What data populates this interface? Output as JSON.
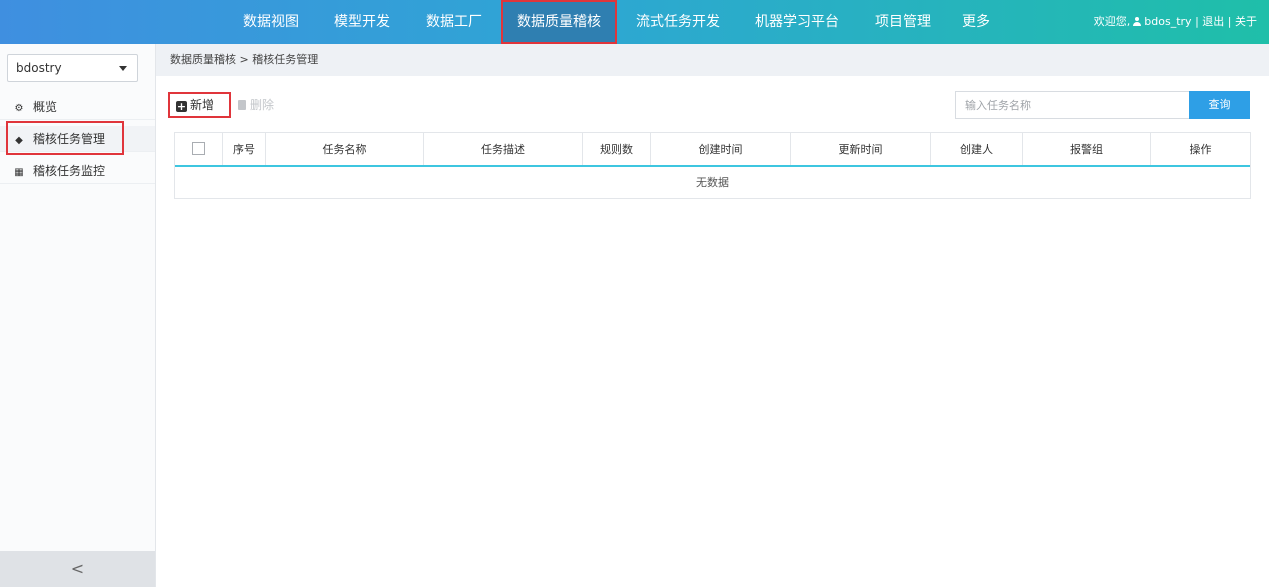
{
  "topnav": {
    "items": [
      {
        "label": "数据视图",
        "active": false
      },
      {
        "label": "模型开发",
        "active": false
      },
      {
        "label": "数据工厂",
        "active": false
      },
      {
        "label": "数据质量稽核",
        "active": true
      },
      {
        "label": "流式任务开发",
        "active": false
      },
      {
        "label": "机器学习平台",
        "active": false
      },
      {
        "label": "项目管理",
        "active": false
      },
      {
        "label": "更多",
        "active": false
      }
    ],
    "welcome": "欢迎您,",
    "username": "bdos_try",
    "separator": "|",
    "logout": "退出",
    "about": "关于"
  },
  "sidebar": {
    "project": "bdostry",
    "items": [
      {
        "label": "概览",
        "icon": "cogs-icon",
        "active": false
      },
      {
        "label": "稽核任务管理",
        "icon": "cube-icon",
        "active": true
      },
      {
        "label": "稽核任务监控",
        "icon": "grid-icon",
        "active": false
      }
    ],
    "collapse": "<"
  },
  "breadcrumb": {
    "parent": "数据质量稽核",
    "sep": ">",
    "current": "稽核任务管理"
  },
  "toolbar": {
    "add_label": "新增",
    "delete_label": "删除"
  },
  "search": {
    "placeholder": "输入任务名称",
    "button": "查询"
  },
  "table": {
    "columns": [
      "序号",
      "任务名称",
      "任务描述",
      "规则数",
      "创建时间",
      "更新时间",
      "创建人",
      "报警组",
      "操作"
    ],
    "empty_text": "无数据"
  },
  "colors": {
    "accent": "#2e9fe6",
    "highlight": "#e0353b",
    "table_header_rule": "#3ec6e0"
  }
}
